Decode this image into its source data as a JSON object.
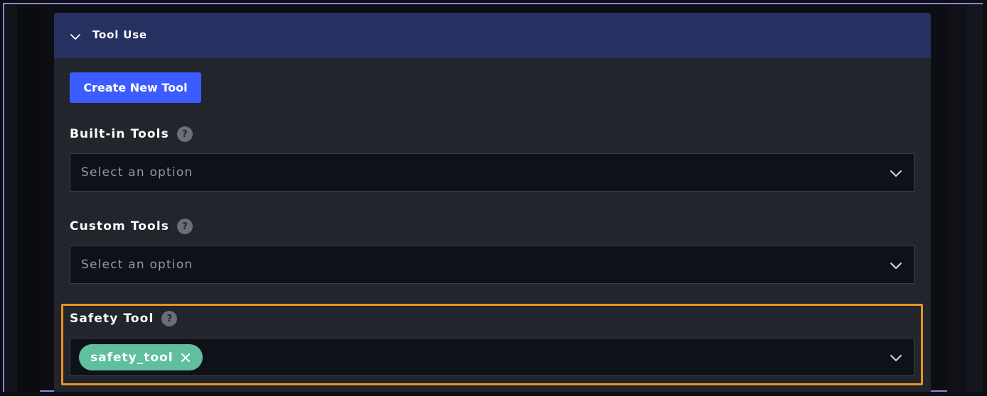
{
  "section": {
    "title": "Tool Use",
    "collapse_icon": "chevron-down-icon"
  },
  "create_button": {
    "label": "Create New Tool"
  },
  "fields": {
    "builtin": {
      "label": "Built-in Tools",
      "help": "?",
      "placeholder": "Select an option"
    },
    "custom": {
      "label": "Custom Tools",
      "help": "?",
      "placeholder": "Select an option"
    },
    "safety": {
      "label": "Safety Tool",
      "help": "?",
      "selected_tag": "safety_tool"
    }
  },
  "colors": {
    "header_bg": "#263061",
    "panel_bg": "#22252c",
    "primary_button": "#3d5cff",
    "tag_bg": "#5fbf9f",
    "highlight_border": "#e9931f"
  }
}
